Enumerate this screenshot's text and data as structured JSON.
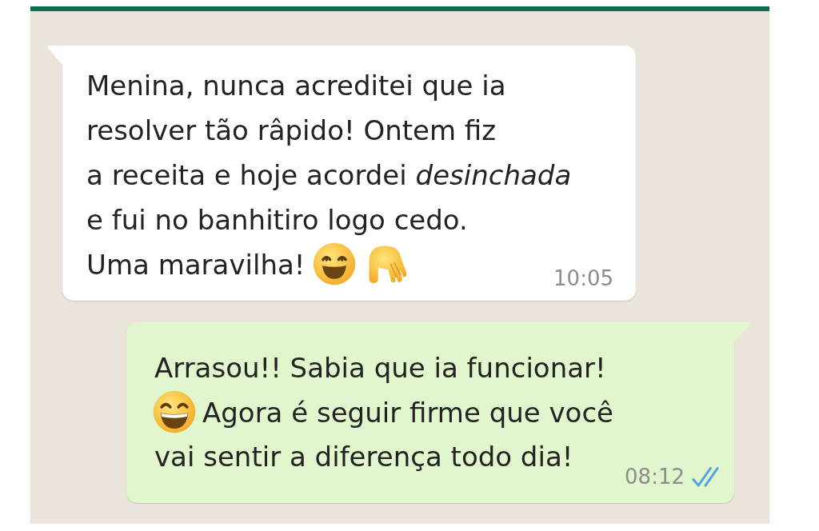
{
  "chat": {
    "messages": [
      {
        "kind": "incoming",
        "blocks": [
          [
            {
              "kind": "text",
              "text": "Menina, nunca acreditei que ia\nresolver tão râpido! Ontem fiz\na receita e hoje acordei *desinchada*\ne fui no banhitiro logo cedo."
            }
          ],
          [
            {
              "kind": "text",
              "text": "Uma maravilha!"
            },
            {
              "kind": "emoji"
            },
            {
              "kind": "emoji"
            }
          ]
        ],
        "time": "10:05"
      },
      {
        "kind": "outgoing",
        "blocks": [
          [
            {
              "kind": "text",
              "text": "Arrasou!! Sabia que ia funcionar!"
            }
          ],
          [
            {
              "kind": "emoji"
            },
            {
              "kind": "text",
              "text": "Agora é seguir firme que você"
            }
          ],
          [
            {
              "kind": "text",
              "text": "vai sentir a diferença todo dia!"
            }
          ]
        ],
        "time": "08:12",
        "read": true
      }
    ]
  }
}
